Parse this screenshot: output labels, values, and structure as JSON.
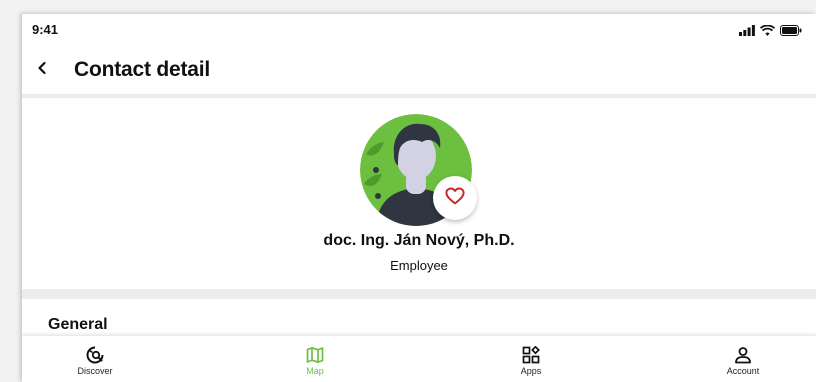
{
  "status_bar": {
    "time": "9:41"
  },
  "header": {
    "title": "Contact detail"
  },
  "contact": {
    "name": "doc. Ing. Ján Nový, Ph.D.",
    "role": "Employee",
    "favorite": true
  },
  "section": {
    "title": "General"
  },
  "tabs": [
    {
      "label": "Discover",
      "icon": "discover-icon",
      "active": false
    },
    {
      "label": "Map",
      "icon": "map-icon",
      "active": true
    },
    {
      "label": "Apps",
      "icon": "apps-icon",
      "active": false
    },
    {
      "label": "Account",
      "icon": "account-icon",
      "active": false
    }
  ],
  "colors": {
    "accent": "#6cbf3f",
    "avatar_bg": "#6cbf3f",
    "favorite": "#c62828",
    "separator": "#ececec"
  }
}
